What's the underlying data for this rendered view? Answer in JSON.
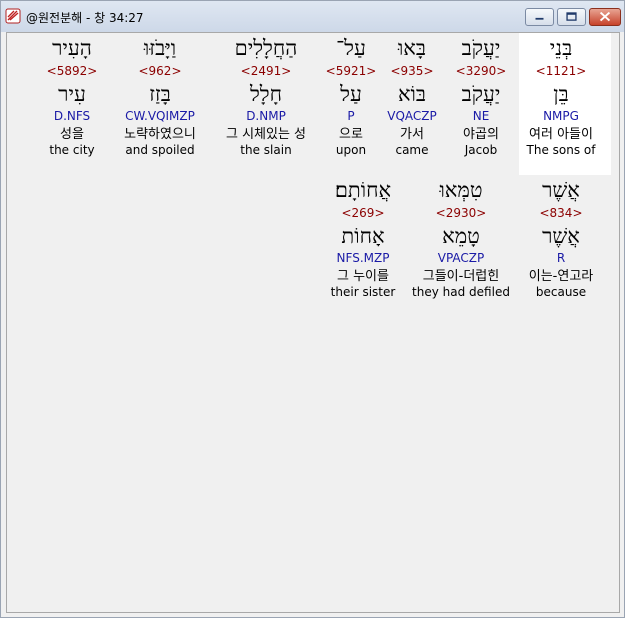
{
  "window": {
    "title": "@원전분해 - 창 34:27"
  },
  "rows": [
    [
      {
        "hebrew": "בְּנֵי",
        "strong": "<1121>",
        "lemma": "בֵּן",
        "morph": "NMPG",
        "korean": "여러 아들이",
        "english": "The sons of"
      },
      {
        "hebrew": "יַעֲקֹב",
        "strong": "<3290>",
        "lemma": "יַעֲקֹב",
        "morph": "NE",
        "korean": "야곱의",
        "english": "Jacob"
      },
      {
        "hebrew": "בָּאוּ",
        "strong": "<935>",
        "lemma": "בּוֹא",
        "morph": "VQACZP",
        "korean": "가서",
        "english": "came"
      },
      {
        "hebrew": "עַל־",
        "strong": "<5921>",
        "lemma": "עַל",
        "morph": "P",
        "korean": "으로",
        "english": "upon"
      },
      {
        "hebrew": "הַחֲלָלִים",
        "strong": "<2491>",
        "lemma": "חָלָל",
        "morph": "D.NMP",
        "korean": "그 시체있는 성",
        "english": "the slain"
      },
      {
        "hebrew": "וַיָּבֹזּוּ",
        "strong": "<962>",
        "lemma": "בָּזַז",
        "morph": "CW.VQIMZP",
        "korean": "노략하였으니",
        "english": "and spoiled"
      },
      {
        "hebrew": "הָעִיר",
        "strong": "<5892>",
        "lemma": "עִיר",
        "morph": "D.NFS",
        "korean": "성을",
        "english": "the city"
      }
    ],
    [
      {
        "hebrew": "אֲשֶׁר",
        "strong": "<834>",
        "lemma": "אֲשֶׁר",
        "morph": "R",
        "korean": "이는-연고라",
        "english": "because"
      },
      {
        "hebrew": "טִמְּאוּ",
        "strong": "<2930>",
        "lemma": "טָמֵא",
        "morph": "VPACZP",
        "korean": "그들이-더럽힌",
        "english": "they had defiled"
      },
      {
        "hebrew": "אֲחוֹתָם׃",
        "strong": "<269>",
        "lemma": "אָחוֹת",
        "morph": "NFS.MZP",
        "korean": "그 누이를",
        "english": "their sister"
      }
    ]
  ]
}
